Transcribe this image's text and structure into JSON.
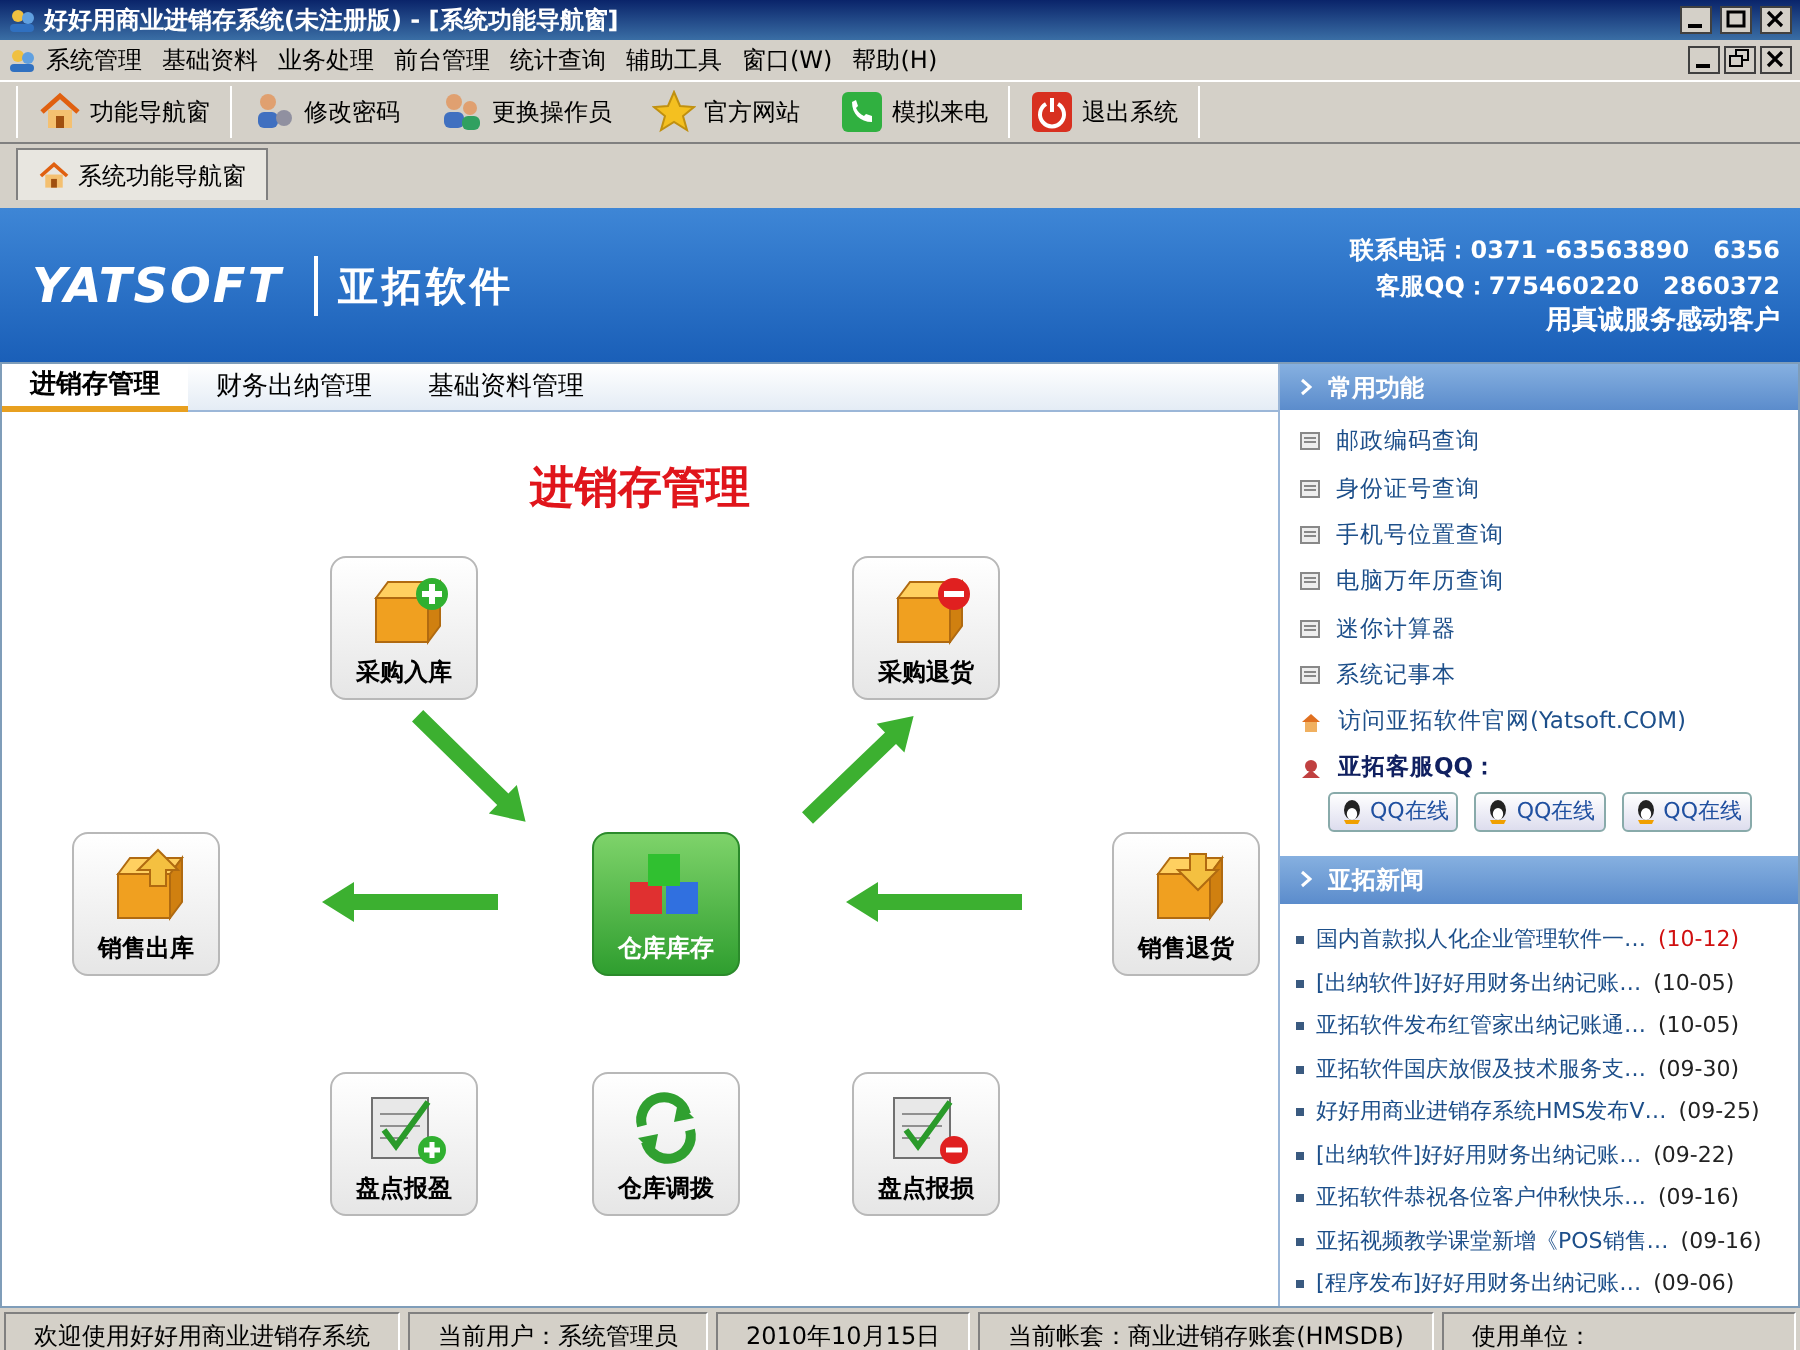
{
  "window": {
    "title": "好好用商业进销存系统(未注册版) - [系统功能导航窗]"
  },
  "menu": [
    "系统管理",
    "基础资料",
    "业务处理",
    "前台管理",
    "统计查询",
    "辅助工具",
    "窗口(W)",
    "帮助(H)"
  ],
  "toolbar": [
    {
      "label": "功能导航窗"
    },
    {
      "label": "修改密码"
    },
    {
      "label": "更换操作员"
    },
    {
      "label": "官方网站"
    },
    {
      "label": "模拟来电"
    },
    {
      "label": "退出系统"
    }
  ],
  "doc_tabs": [
    {
      "label": "系统功能导航窗",
      "selected": true
    }
  ],
  "banner": {
    "logo": "YATSOFT",
    "brand": "亚拓软件",
    "phone": "联系电话：0371 -63563890　6356",
    "qq": "客服QQ：775460220　2860372",
    "slogan": "用真诚服务感动客户"
  },
  "tabs": [
    {
      "label": "进销存管理",
      "selected": true
    },
    {
      "label": "财务出纳管理",
      "selected": false
    },
    {
      "label": "基础资料管理",
      "selected": false
    }
  ],
  "diagram": {
    "title": "进销存管理",
    "nodes": [
      {
        "label": "采购入库"
      },
      {
        "label": "采购退货"
      },
      {
        "label": "销售出库"
      },
      {
        "label": "仓库库存"
      },
      {
        "label": "销售退货"
      },
      {
        "label": "盘点报盈"
      },
      {
        "label": "仓库调拨"
      },
      {
        "label": "盘点报损"
      }
    ]
  },
  "common": {
    "title": "常用功能",
    "items": [
      {
        "kind": "doc",
        "label": "邮政编码查询"
      },
      {
        "kind": "doc",
        "label": "身份证号查询"
      },
      {
        "kind": "doc",
        "label": "手机号位置查询"
      },
      {
        "kind": "doc",
        "label": "电脑万年历查询"
      },
      {
        "kind": "doc",
        "label": "迷你计算器"
      },
      {
        "kind": "doc",
        "label": "系统记事本"
      },
      {
        "kind": "home",
        "label": "访问亚拓软件官网(Yatsoft.COM)"
      },
      {
        "kind": "qq",
        "label": "亚拓客服QQ："
      }
    ],
    "qq_buttons": [
      "QQ在线",
      "QQ在线",
      "QQ在线"
    ]
  },
  "news": {
    "title": "亚拓新闻",
    "items": [
      {
        "title": "国内首款拟人化企业管理软件一…",
        "date": "(10-12)",
        "new": true
      },
      {
        "title": "[出纳软件]好好用财务出纳记账…",
        "date": "(10-05)",
        "new": false
      },
      {
        "title": "亚拓软件发布红管家出纳记账通…",
        "date": "(10-05)",
        "new": false
      },
      {
        "title": "亚拓软件国庆放假及技术服务支…",
        "date": "(09-30)",
        "new": false
      },
      {
        "title": "好好用商业进销存系统HMS发布V…",
        "date": "(09-25)",
        "new": false
      },
      {
        "title": "[出纳软件]好好用财务出纳记账…",
        "date": "(09-22)",
        "new": false
      },
      {
        "title": "亚拓软件恭祝各位客户仲秋快乐…",
        "date": "(09-16)",
        "new": false
      },
      {
        "title": "亚拓视频教学课堂新增《POS销售…",
        "date": "(09-16)",
        "new": false
      },
      {
        "title": "[程序发布]好好用财务出纳记账…",
        "date": "(09-06)",
        "new": false
      }
    ]
  },
  "status_bar": [
    "欢迎使用好好用商业进销存系统",
    "当前用户：系统管理员",
    "2010年10月15日",
    "当前帐套：商业进销存账套(HMSDB)",
    "使用单位："
  ]
}
